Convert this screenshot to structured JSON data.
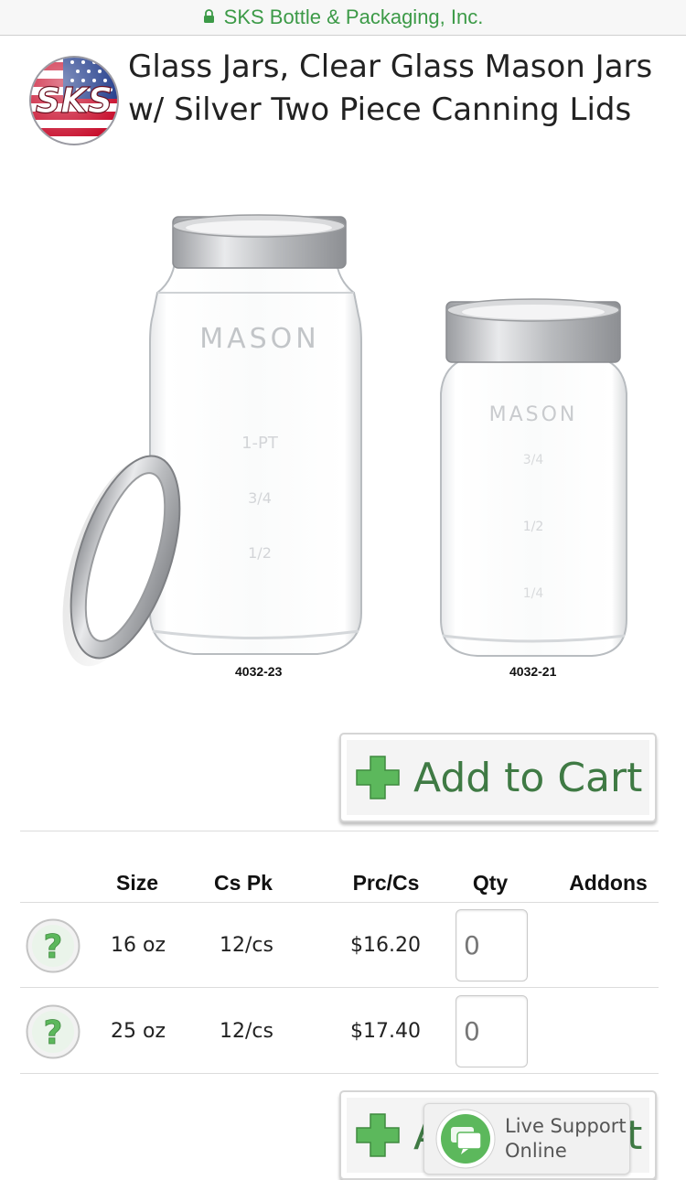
{
  "browser": {
    "url_text": "SKS Bottle & Packaging, Inc.",
    "accent_color": "#3c9a47"
  },
  "logo": {
    "text": "SKS"
  },
  "product": {
    "title": "Glass Jars, Clear Glass Mason Jars w/ Silver Two Piece Canning Lids",
    "images": [
      {
        "sku": "4032-23",
        "jar_text": "MASON",
        "markings": [
          "1-PT",
          "3/4",
          "1/2"
        ]
      },
      {
        "sku": "4032-21",
        "jar_text": "MASON",
        "markings": [
          "3/4",
          "1/2",
          "1/4"
        ]
      }
    ]
  },
  "cart": {
    "add_label": "Add to Cart",
    "icon": "plus-icon",
    "icon_color": "#5cb85c",
    "label_color": "#3f7a44"
  },
  "table": {
    "headers": {
      "size": "Size",
      "cspk": "Cs Pk",
      "price": "Prc/Cs",
      "qty": "Qty",
      "addons": "Addons"
    },
    "rows": [
      {
        "help_icon": "question-icon",
        "size": "16 oz",
        "cspk": "12/cs",
        "price": "$16.20",
        "qty": "0"
      },
      {
        "help_icon": "question-icon",
        "size": "25 oz",
        "cspk": "12/cs",
        "price": "$17.40",
        "qty": "0"
      }
    ]
  },
  "live_support": {
    "line1": "Live Support",
    "line2": "Online",
    "icon": "chat-bubble-icon",
    "color": "#5cb85c"
  }
}
